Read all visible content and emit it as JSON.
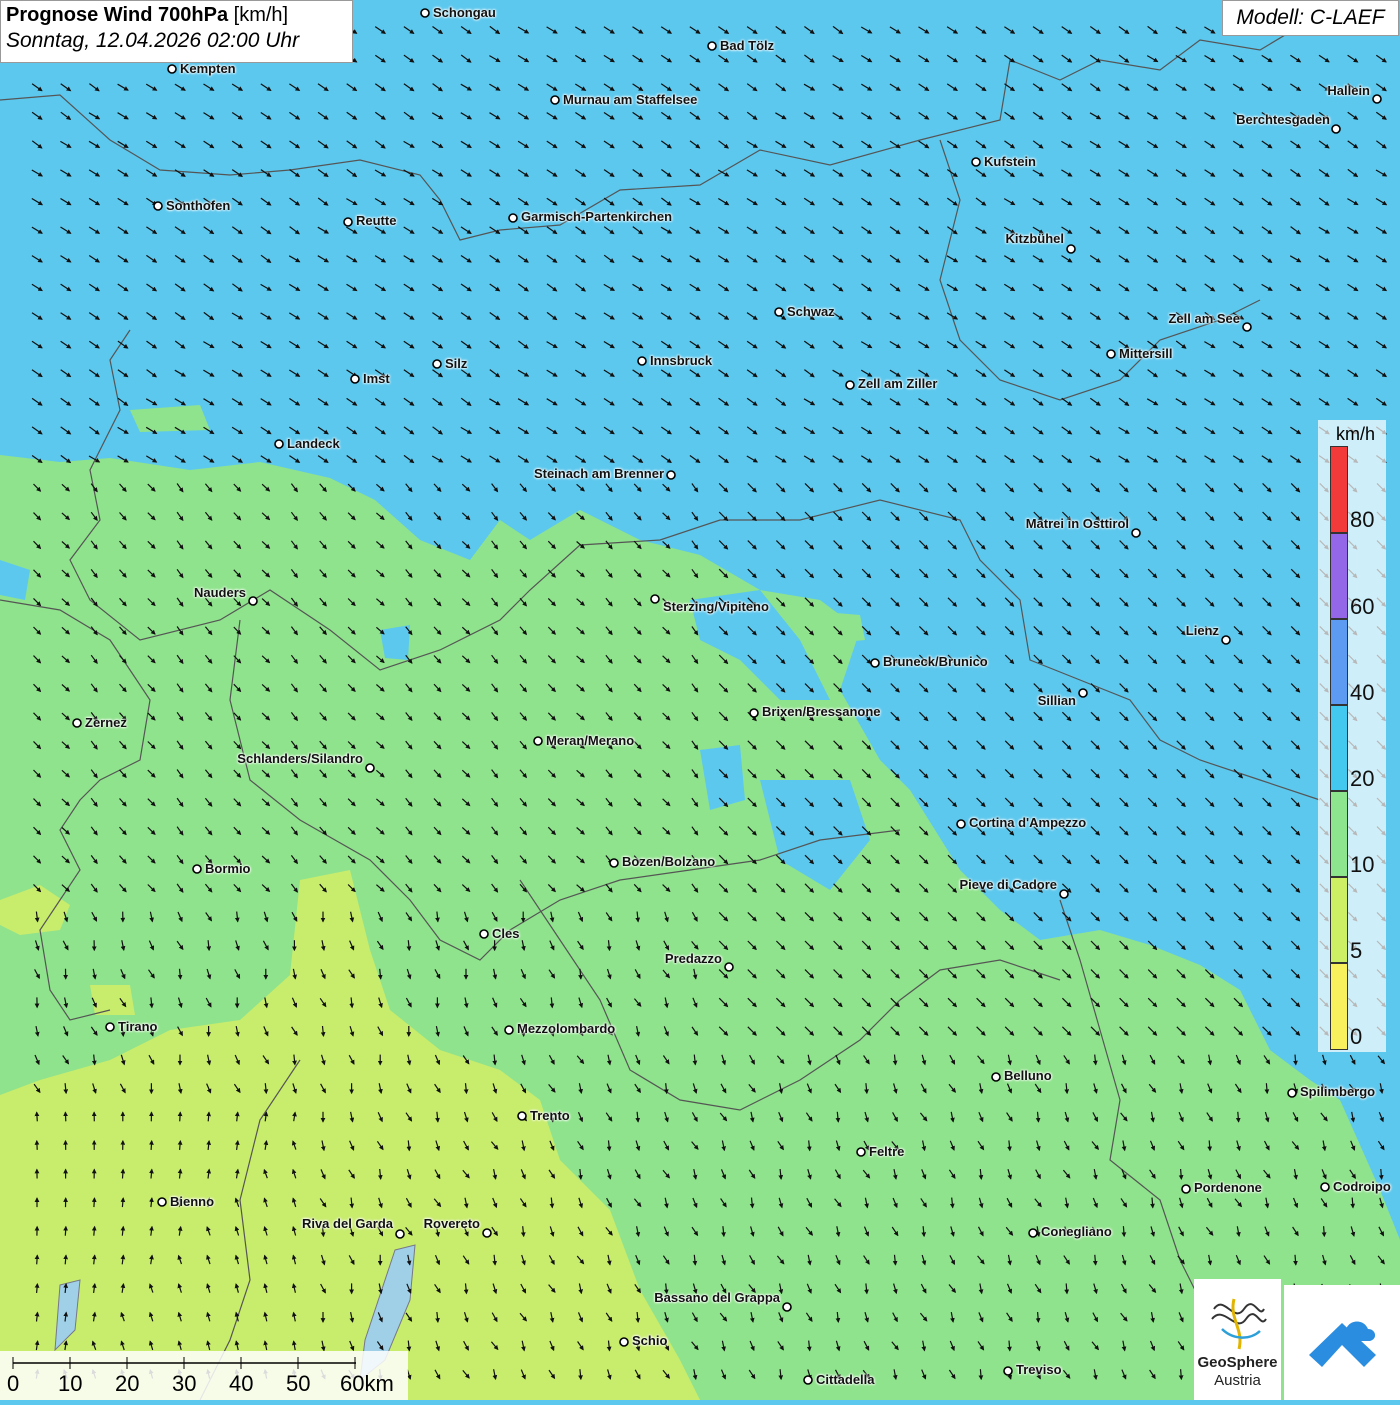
{
  "title": {
    "main": "Prognose Wind 700hPa",
    "unit": "[km/h]",
    "datetime": "Sonntag, 12.04.2026 02:00 Uhr"
  },
  "model": "Modell: C-LAEF",
  "legend": {
    "unit": "km/h",
    "colors": [
      "#f9f05e",
      "#cdef63",
      "#8de58d",
      "#43c8f0",
      "#5d9bf2",
      "#9466e8",
      "#f23a3a"
    ],
    "labels": [
      "0",
      "5",
      "10",
      "20",
      "40",
      "60",
      "80"
    ]
  },
  "scale": {
    "labels": [
      "0",
      "10",
      "20",
      "30",
      "40",
      "50",
      "60km"
    ]
  },
  "logo": {
    "line1": "GeoSphere",
    "line2": "Austria"
  },
  "cities": [
    {
      "name": "Schongau"
    },
    {
      "name": "Bad Tölz"
    },
    {
      "name": "Kempten"
    },
    {
      "name": "Murnau am Staffelsee"
    },
    {
      "name": "Hallein"
    },
    {
      "name": "Berchtesgaden"
    },
    {
      "name": "Kufstein"
    },
    {
      "name": "Sonthofen"
    },
    {
      "name": "Reutte"
    },
    {
      "name": "Garmisch-Partenkirchen"
    },
    {
      "name": "Kitzbühel"
    },
    {
      "name": "Schwaz"
    },
    {
      "name": "Zell am See"
    },
    {
      "name": "Mittersill"
    },
    {
      "name": "Innsbruck"
    },
    {
      "name": "Silz"
    },
    {
      "name": "Imst"
    },
    {
      "name": "Zell am Ziller"
    },
    {
      "name": "Landeck"
    },
    {
      "name": "Steinach am Brenner"
    },
    {
      "name": "Matrei in Osttirol"
    },
    {
      "name": "Nauders"
    },
    {
      "name": "Sterzing/Vipiteno"
    },
    {
      "name": "Lienz"
    },
    {
      "name": "Bruneck/Brunico"
    },
    {
      "name": "Sillian"
    },
    {
      "name": "Zernez"
    },
    {
      "name": "Brixen/Bressanone"
    },
    {
      "name": "Meran/Merano"
    },
    {
      "name": "Schlanders/Silandro"
    },
    {
      "name": "Cortina d'Ampezzo"
    },
    {
      "name": "Bormio"
    },
    {
      "name": "Bozen/Bolzano"
    },
    {
      "name": "Pieve di Cadore"
    },
    {
      "name": "Cles"
    },
    {
      "name": "Predazzo"
    },
    {
      "name": "Tirano"
    },
    {
      "name": "Mezzolombardo"
    },
    {
      "name": "Belluno"
    },
    {
      "name": "Spilimbergo"
    },
    {
      "name": "Trento"
    },
    {
      "name": "Feltre"
    },
    {
      "name": "Bienno"
    },
    {
      "name": "Pordenone"
    },
    {
      "name": "Codroipo"
    },
    {
      "name": "Riva del Garda"
    },
    {
      "name": "Rovereto"
    },
    {
      "name": "Conegliano"
    },
    {
      "name": "Bassano del Grappa"
    },
    {
      "name": "Schio"
    },
    {
      "name": "Treviso"
    },
    {
      "name": "Cittadella"
    }
  ]
}
